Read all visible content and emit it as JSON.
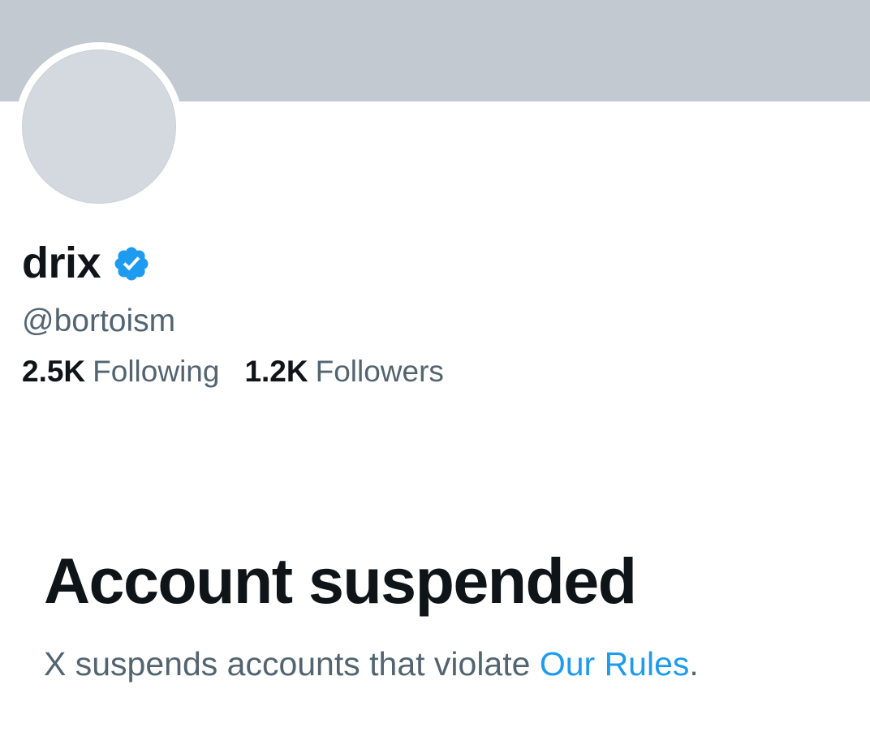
{
  "profile": {
    "display_name": "drix",
    "handle": "@bortoism",
    "verified_badge_icon": "verified-badge-icon",
    "verified_badge_color": "#1d9bf0"
  },
  "stats": {
    "following_count": "2.5K",
    "following_label": "Following",
    "followers_count": "1.2K",
    "followers_label": "Followers"
  },
  "suspension": {
    "title": "Account suspended",
    "message_prefix": "X suspends accounts that violate ",
    "rules_link": "Our Rules",
    "message_suffix": "."
  },
  "colors": {
    "banner": "#c3c9d0",
    "avatar_placeholder": "#d3d9df",
    "primary_text": "#0f1419",
    "secondary_text": "#536471",
    "link": "#1d9bf0"
  }
}
